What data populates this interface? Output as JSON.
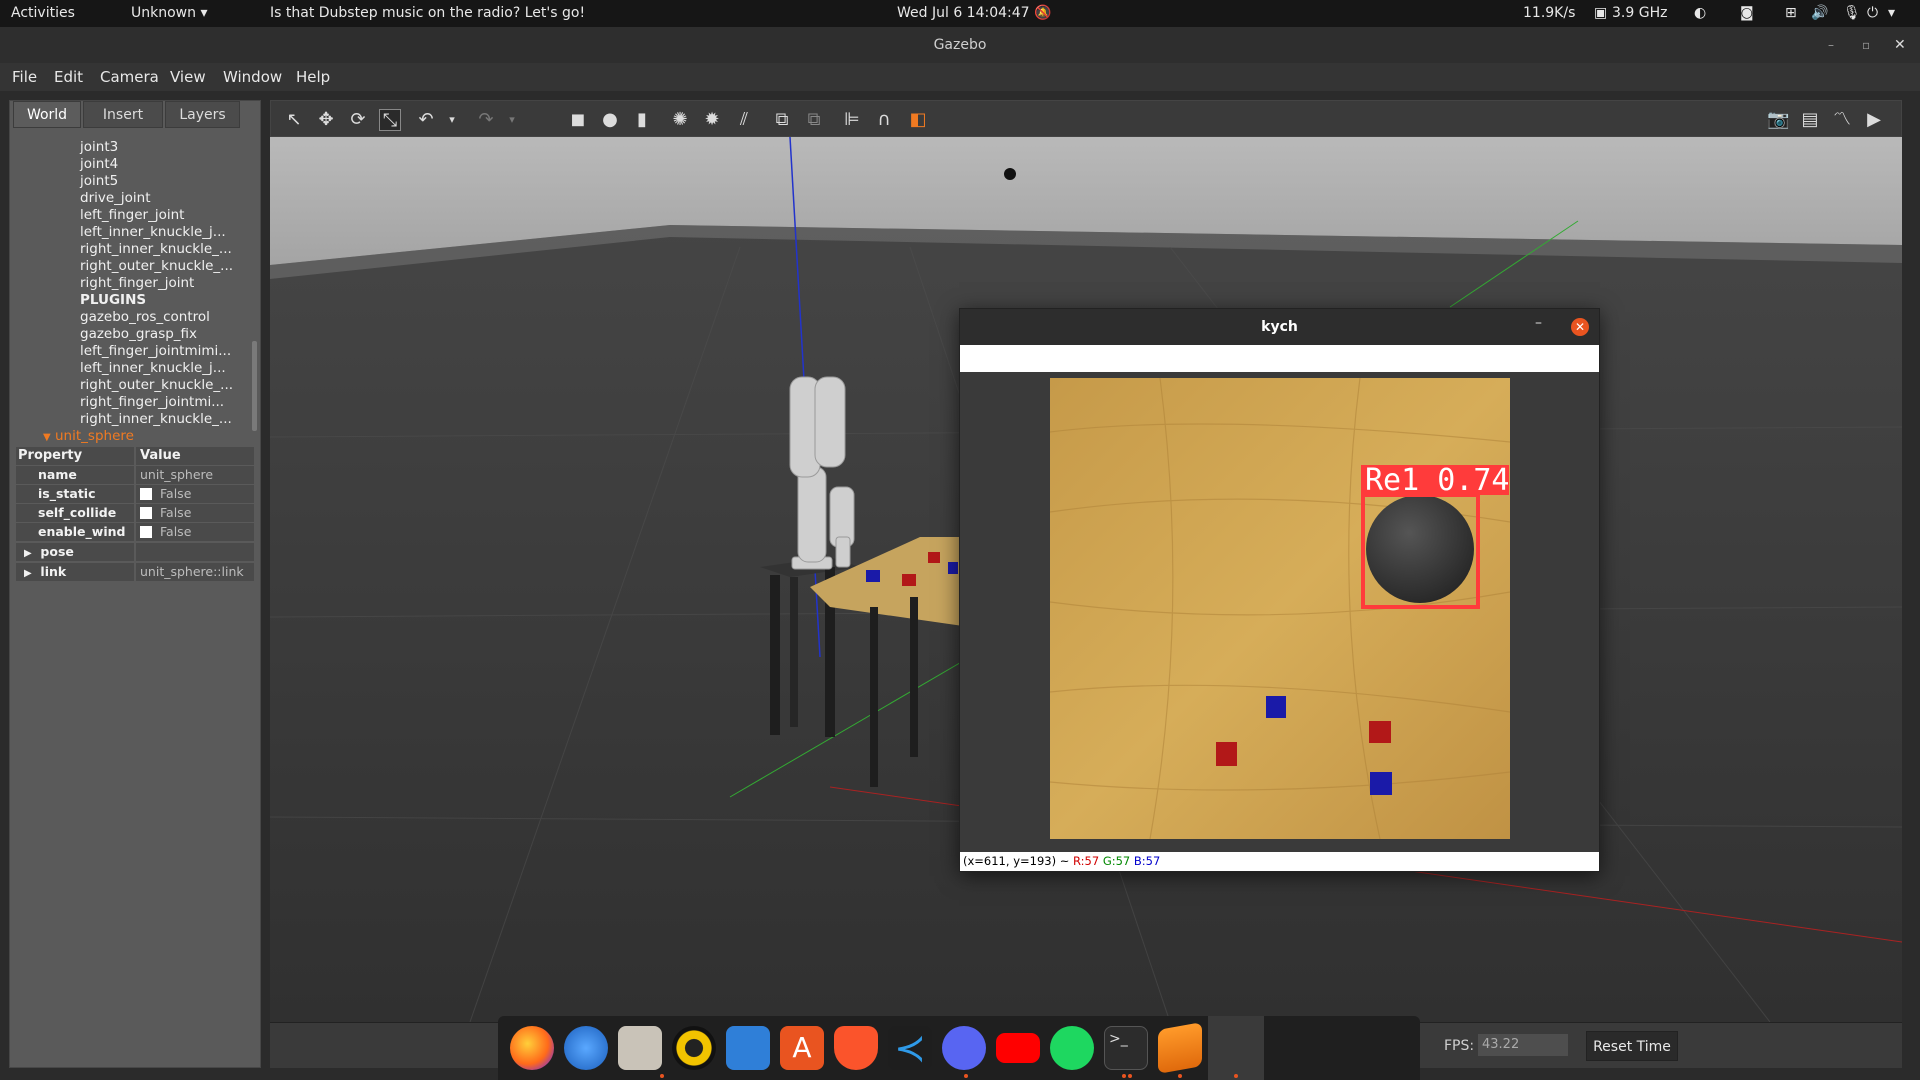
{
  "topbar": {
    "activities": "Activities",
    "app_menu": "Unknown",
    "now_playing": "Is that Dubstep music on the radio? Let's go!",
    "clock": "Wed Jul 6  14:04:47",
    "net_speed": "11.9K/s",
    "cpu_freq": "3.9 GHz"
  },
  "window": {
    "title": "Gazebo"
  },
  "menu": [
    "File",
    "Edit",
    "Camera",
    "View",
    "Window",
    "Help"
  ],
  "left_panel": {
    "tabs": [
      "World",
      "Insert",
      "Layers"
    ],
    "tree_items": [
      "joint3",
      "joint4",
      "joint5",
      "drive_joint",
      "left_finger_joint",
      "left_inner_knuckle_j...",
      "right_inner_knuckle_...",
      "right_outer_knuckle_...",
      "right_finger_joint",
      "PLUGINS",
      "gazebo_ros_control",
      "gazebo_grasp_fix",
      "left_finger_jointmimi...",
      "left_inner_knuckle_j...",
      "right_outer_knuckle_...",
      "right_finger_jointmi...",
      "right_inner_knuckle_..."
    ],
    "selected_model": "unit_sphere",
    "properties": {
      "header_property": "Property",
      "header_value": "Value",
      "rows": [
        {
          "key": "name",
          "value": "unit_sphere"
        },
        {
          "key": "is_static",
          "value": "False"
        },
        {
          "key": "self_collide",
          "value": "False"
        },
        {
          "key": "enable_wind",
          "value": "False"
        },
        {
          "key": "pose",
          "value": ""
        },
        {
          "key": "link",
          "value": "unit_sphere::link"
        }
      ]
    }
  },
  "kych_window": {
    "title": "kych",
    "detection_label": "Re1  0.74",
    "status_coords": "(x=611, y=193) ~",
    "status_r": "R:57",
    "status_g": "G:57",
    "status_b": "B:57"
  },
  "bottom": {
    "fps_label": "FPS:",
    "fps_value": "43.22",
    "reset_time": "Reset Time"
  },
  "colors": {
    "accent": "#e95420",
    "detection_box": "#ff3b3b"
  }
}
